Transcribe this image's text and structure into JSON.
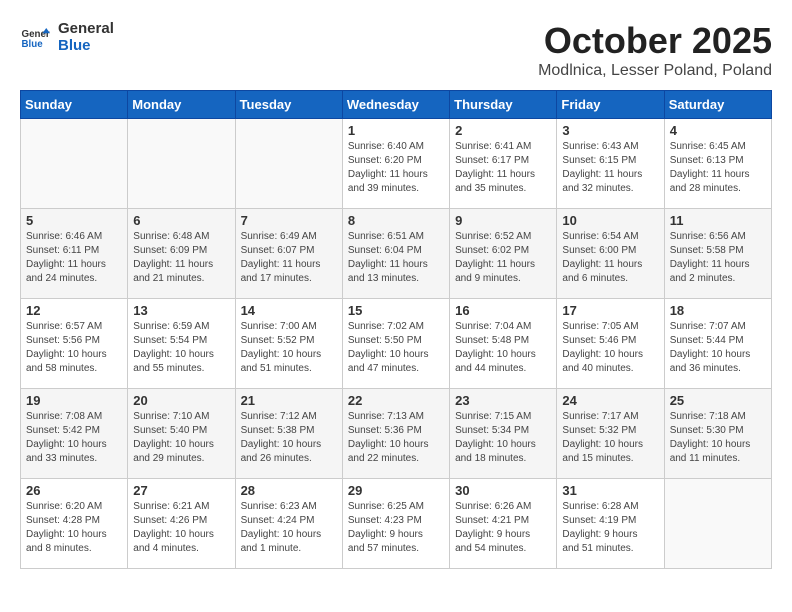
{
  "header": {
    "logo_general": "General",
    "logo_blue": "Blue",
    "month_title": "October 2025",
    "location": "Modlnica, Lesser Poland, Poland"
  },
  "days_of_week": [
    "Sunday",
    "Monday",
    "Tuesday",
    "Wednesday",
    "Thursday",
    "Friday",
    "Saturday"
  ],
  "weeks": [
    [
      {
        "day": "",
        "info": ""
      },
      {
        "day": "",
        "info": ""
      },
      {
        "day": "",
        "info": ""
      },
      {
        "day": "1",
        "info": "Sunrise: 6:40 AM\nSunset: 6:20 PM\nDaylight: 11 hours\nand 39 minutes."
      },
      {
        "day": "2",
        "info": "Sunrise: 6:41 AM\nSunset: 6:17 PM\nDaylight: 11 hours\nand 35 minutes."
      },
      {
        "day": "3",
        "info": "Sunrise: 6:43 AM\nSunset: 6:15 PM\nDaylight: 11 hours\nand 32 minutes."
      },
      {
        "day": "4",
        "info": "Sunrise: 6:45 AM\nSunset: 6:13 PM\nDaylight: 11 hours\nand 28 minutes."
      }
    ],
    [
      {
        "day": "5",
        "info": "Sunrise: 6:46 AM\nSunset: 6:11 PM\nDaylight: 11 hours\nand 24 minutes."
      },
      {
        "day": "6",
        "info": "Sunrise: 6:48 AM\nSunset: 6:09 PM\nDaylight: 11 hours\nand 21 minutes."
      },
      {
        "day": "7",
        "info": "Sunrise: 6:49 AM\nSunset: 6:07 PM\nDaylight: 11 hours\nand 17 minutes."
      },
      {
        "day": "8",
        "info": "Sunrise: 6:51 AM\nSunset: 6:04 PM\nDaylight: 11 hours\nand 13 minutes."
      },
      {
        "day": "9",
        "info": "Sunrise: 6:52 AM\nSunset: 6:02 PM\nDaylight: 11 hours\nand 9 minutes."
      },
      {
        "day": "10",
        "info": "Sunrise: 6:54 AM\nSunset: 6:00 PM\nDaylight: 11 hours\nand 6 minutes."
      },
      {
        "day": "11",
        "info": "Sunrise: 6:56 AM\nSunset: 5:58 PM\nDaylight: 11 hours\nand 2 minutes."
      }
    ],
    [
      {
        "day": "12",
        "info": "Sunrise: 6:57 AM\nSunset: 5:56 PM\nDaylight: 10 hours\nand 58 minutes."
      },
      {
        "day": "13",
        "info": "Sunrise: 6:59 AM\nSunset: 5:54 PM\nDaylight: 10 hours\nand 55 minutes."
      },
      {
        "day": "14",
        "info": "Sunrise: 7:00 AM\nSunset: 5:52 PM\nDaylight: 10 hours\nand 51 minutes."
      },
      {
        "day": "15",
        "info": "Sunrise: 7:02 AM\nSunset: 5:50 PM\nDaylight: 10 hours\nand 47 minutes."
      },
      {
        "day": "16",
        "info": "Sunrise: 7:04 AM\nSunset: 5:48 PM\nDaylight: 10 hours\nand 44 minutes."
      },
      {
        "day": "17",
        "info": "Sunrise: 7:05 AM\nSunset: 5:46 PM\nDaylight: 10 hours\nand 40 minutes."
      },
      {
        "day": "18",
        "info": "Sunrise: 7:07 AM\nSunset: 5:44 PM\nDaylight: 10 hours\nand 36 minutes."
      }
    ],
    [
      {
        "day": "19",
        "info": "Sunrise: 7:08 AM\nSunset: 5:42 PM\nDaylight: 10 hours\nand 33 minutes."
      },
      {
        "day": "20",
        "info": "Sunrise: 7:10 AM\nSunset: 5:40 PM\nDaylight: 10 hours\nand 29 minutes."
      },
      {
        "day": "21",
        "info": "Sunrise: 7:12 AM\nSunset: 5:38 PM\nDaylight: 10 hours\nand 26 minutes."
      },
      {
        "day": "22",
        "info": "Sunrise: 7:13 AM\nSunset: 5:36 PM\nDaylight: 10 hours\nand 22 minutes."
      },
      {
        "day": "23",
        "info": "Sunrise: 7:15 AM\nSunset: 5:34 PM\nDaylight: 10 hours\nand 18 minutes."
      },
      {
        "day": "24",
        "info": "Sunrise: 7:17 AM\nSunset: 5:32 PM\nDaylight: 10 hours\nand 15 minutes."
      },
      {
        "day": "25",
        "info": "Sunrise: 7:18 AM\nSunset: 5:30 PM\nDaylight: 10 hours\nand 11 minutes."
      }
    ],
    [
      {
        "day": "26",
        "info": "Sunrise: 6:20 AM\nSunset: 4:28 PM\nDaylight: 10 hours\nand 8 minutes."
      },
      {
        "day": "27",
        "info": "Sunrise: 6:21 AM\nSunset: 4:26 PM\nDaylight: 10 hours\nand 4 minutes."
      },
      {
        "day": "28",
        "info": "Sunrise: 6:23 AM\nSunset: 4:24 PM\nDaylight: 10 hours\nand 1 minute."
      },
      {
        "day": "29",
        "info": "Sunrise: 6:25 AM\nSunset: 4:23 PM\nDaylight: 9 hours\nand 57 minutes."
      },
      {
        "day": "30",
        "info": "Sunrise: 6:26 AM\nSunset: 4:21 PM\nDaylight: 9 hours\nand 54 minutes."
      },
      {
        "day": "31",
        "info": "Sunrise: 6:28 AM\nSunset: 4:19 PM\nDaylight: 9 hours\nand 51 minutes."
      },
      {
        "day": "",
        "info": ""
      }
    ]
  ]
}
